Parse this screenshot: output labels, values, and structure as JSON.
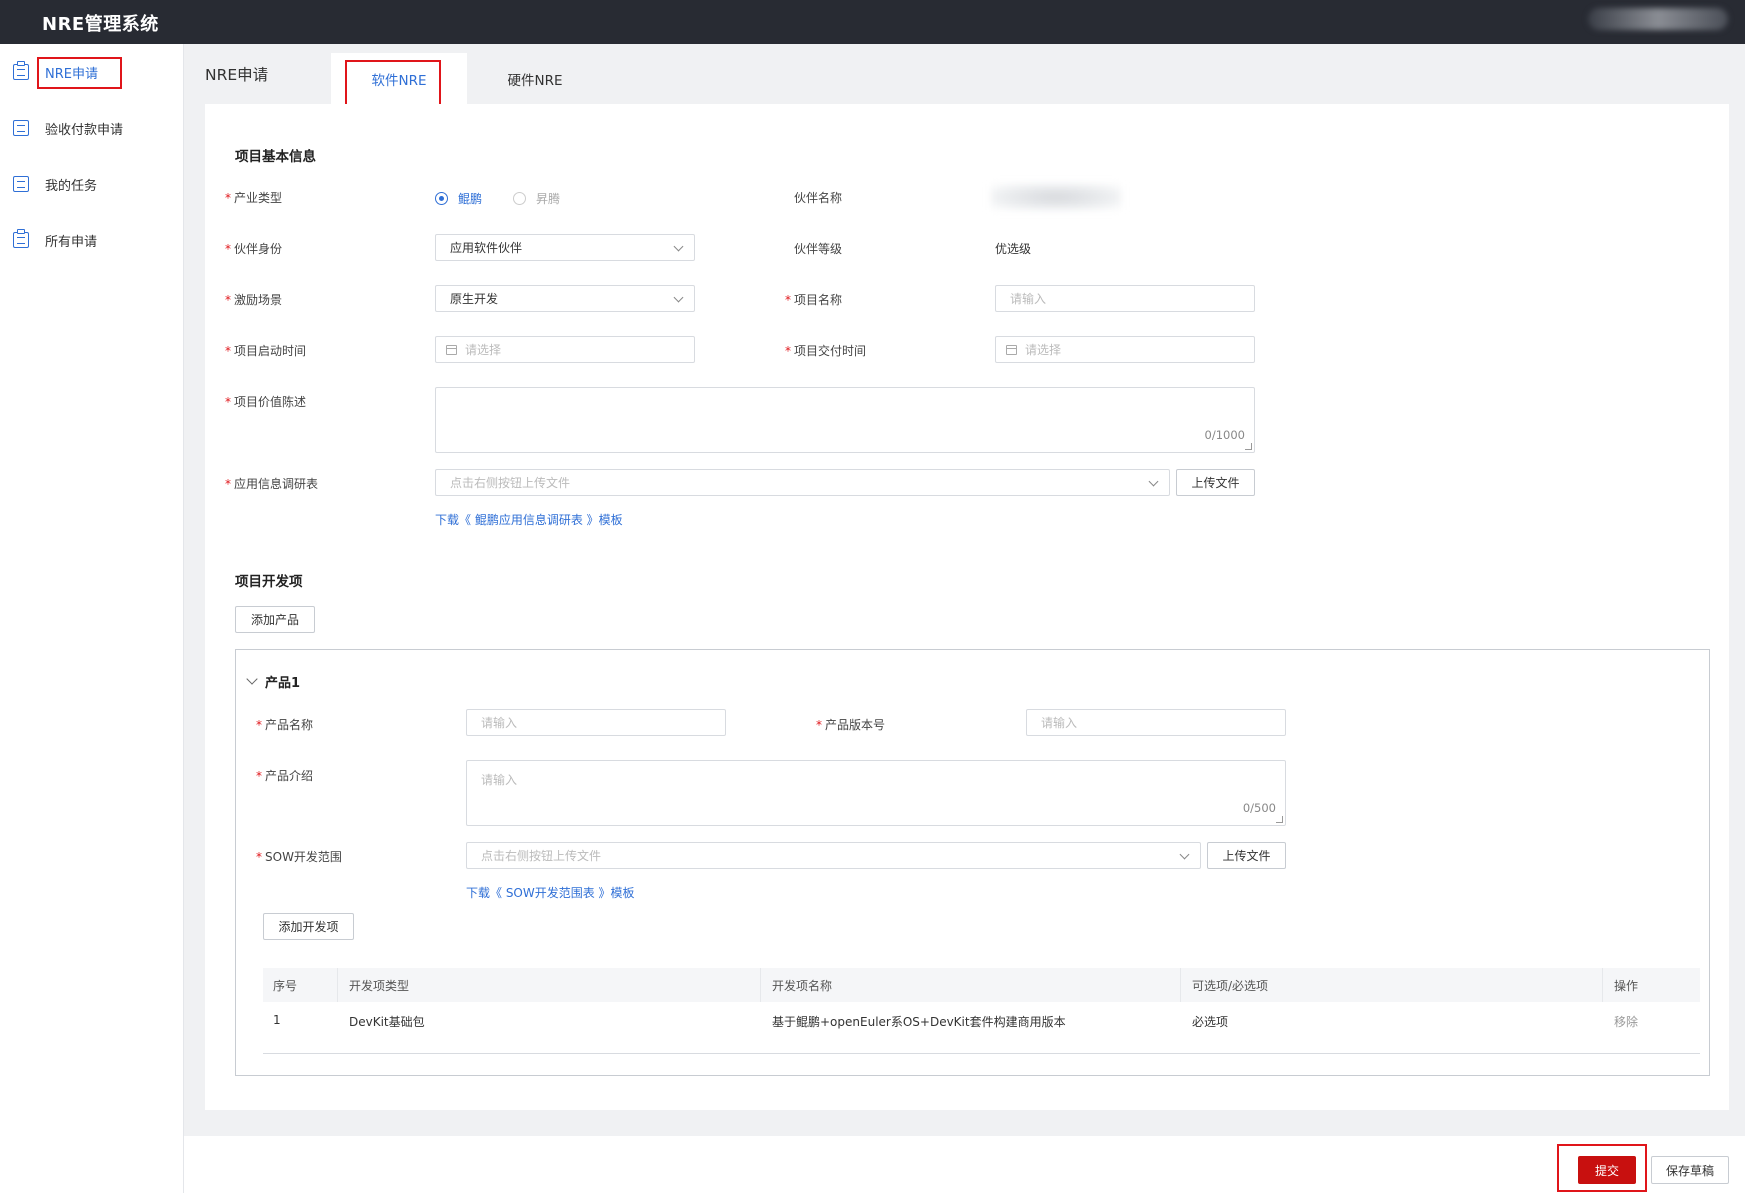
{
  "app": {
    "title": "NRE管理系统"
  },
  "sidebar": {
    "items": [
      {
        "label": "NRE申请",
        "active": true
      },
      {
        "label": "验收付款申请"
      },
      {
        "label": "我的任务"
      },
      {
        "label": "所有申请"
      }
    ]
  },
  "header": {
    "breadcrumb": "NRE申请",
    "tabs": [
      {
        "label": "软件NRE",
        "active": true
      },
      {
        "label": "硬件NRE"
      }
    ]
  },
  "basic": {
    "title": "项目基本信息",
    "industry_type_label": "产业类型",
    "industry_options": [
      "鲲鹏",
      "昇腾"
    ],
    "partner_name_label": "伙伴名称",
    "partner_identity_label": "伙伴身份",
    "partner_identity_value": "应用软件伙伴",
    "partner_level_label": "伙伴等级",
    "partner_level_value": "优选级",
    "incentive_label": "激励场景",
    "incentive_value": "原生开发",
    "project_name_label": "项目名称",
    "project_name_placeholder": "请输入",
    "start_time_label": "项目启动时间",
    "start_time_placeholder": "请选择",
    "delivery_time_label": "项目交付时间",
    "delivery_time_placeholder": "请选择",
    "value_desc_label": "项目价值陈述",
    "value_desc_counter": "0/1000",
    "survey_label": "应用信息调研表",
    "survey_placeholder": "点击右侧按钮上传文件",
    "upload_label": "上传文件",
    "survey_download": "下载《 鲲鹏应用信息调研表 》模板"
  },
  "dev": {
    "title": "项目开发项",
    "add_product_label": "添加产品",
    "product": {
      "title": "产品1",
      "name_label": "产品名称",
      "name_placeholder": "请输入",
      "version_label": "产品版本号",
      "version_placeholder": "请输入",
      "intro_label": "产品介绍",
      "intro_placeholder": "请输入",
      "intro_counter": "0/500",
      "sow_label": "SOW开发范围",
      "sow_placeholder": "点击右侧按钮上传文件",
      "upload_label": "上传文件",
      "sow_download": "下载《 SOW开发范围表 》模板",
      "add_item_label": "添加开发项",
      "table": {
        "columns": [
          "序号",
          "开发项类型",
          "开发项名称",
          "可选项/必选项",
          "操作"
        ],
        "rows": [
          {
            "index": "1",
            "type": "DevKit基础包",
            "name": "基于鲲鹏+openEuler系OS+DevKit套件构建商用版本",
            "required": "必选项",
            "action": "移除"
          }
        ]
      }
    }
  },
  "footer": {
    "submit_label": "提交",
    "draft_label": "保存草稿"
  },
  "colors": {
    "accent": "#2f6fd6",
    "submit": "#c8100f",
    "required_star": "#e0151a",
    "topbar": "#282b33"
  }
}
